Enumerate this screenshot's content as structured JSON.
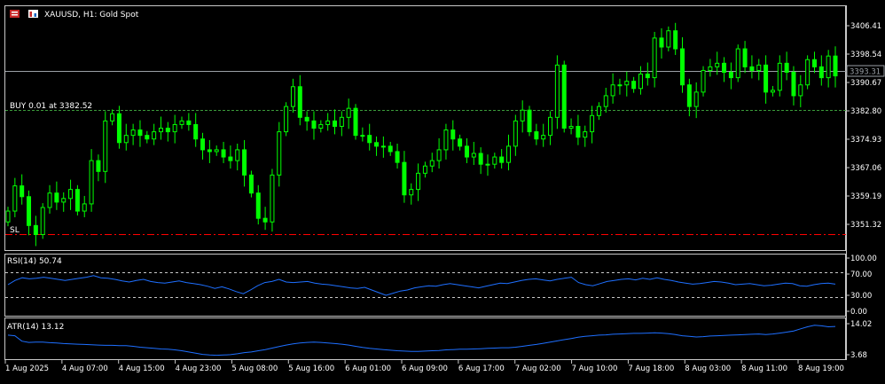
{
  "header": {
    "symbol_title": "XAUUSD, H1:  Gold Spot"
  },
  "trade": {
    "buy_label": "BUY 0.01 at 3382.52",
    "sl_label": "SL",
    "current_price_label": "3393.31"
  },
  "colors": {
    "background": "#000000",
    "candles": "#00ff00",
    "grid_border": "#c8c8c8",
    "buy_line": "#3a9a3a",
    "sl_line": "#ff0000",
    "indicator_line": "#1e6fff",
    "price_box": "#000000"
  },
  "chart_data": [
    {
      "type": "candlestick",
      "title": "XAUUSD, H1:  Gold Spot",
      "y_ticks": [
        "3406.41",
        "3398.54",
        "3390.67",
        "3382.80",
        "3374.93",
        "3367.06",
        "3359.19",
        "3351.32"
      ],
      "ylim": [
        3346.5,
        3410.5
      ],
      "x_tick_labels": [
        "1 Aug 2025",
        "4 Aug 07:00",
        "4 Aug 15:00",
        "4 Aug 23:00",
        "5 Aug 08:00",
        "5 Aug 16:00",
        "6 Aug 01:00",
        "6 Aug 09:00",
        "6 Aug 17:00",
        "7 Aug 02:00",
        "7 Aug 10:00",
        "7 Aug 18:00",
        "8 Aug 03:00",
        "8 Aug 11:00",
        "8 Aug 19:00"
      ],
      "buy_price": 3382.52,
      "stop_loss": 3348.5,
      "current_price": 3393.31,
      "closes": [
        3355.0,
        3362.0,
        3359.0,
        3351.0,
        3348.5,
        3356.0,
        3360.0,
        3357.5,
        3358.5,
        3361.0,
        3355.0,
        3357.0,
        3369.0,
        3366.0,
        3380.0,
        3382.0,
        3374.0,
        3376.0,
        3377.5,
        3376.0,
        3375.0,
        3377.0,
        3378.0,
        3377.0,
        3379.0,
        3380.0,
        3379.0,
        3375.0,
        3372.0,
        3371.5,
        3372.0,
        3370.0,
        3369.0,
        3372.0,
        3365.0,
        3360.0,
        3353.0,
        3352.0,
        3365.0,
        3377.0,
        3384.0,
        3389.5,
        3381.0,
        3380.0,
        3378.0,
        3379.0,
        3380.0,
        3378.5,
        3381.0,
        3383.5,
        3376.0,
        3376.0,
        3374.0,
        3373.0,
        3373.0,
        3371.5,
        3368.5,
        3359.5,
        3361.0,
        3365.5,
        3367.5,
        3369.0,
        3372.0,
        3377.5,
        3375.0,
        3373.0,
        3370.0,
        3371.0,
        3368.0,
        3368.0,
        3370.0,
        3368.5,
        3373.0,
        3380.0,
        3383.0,
        3377.0,
        3375.0,
        3376.0,
        3381.0,
        3395.5,
        3378.0,
        3378.5,
        3375.5,
        3377.0,
        3381.5,
        3384.0,
        3387.0,
        3390.0,
        3390.0,
        3391.0,
        3389.0,
        3393.0,
        3392.0,
        3403.0,
        3400.5,
        3405.0,
        3400.0,
        3390.0,
        3384.0,
        3388.0,
        3394.0,
        3395.0,
        3396.0,
        3393.5,
        3392.0,
        3400.0,
        3395.0,
        3394.0,
        3395.5,
        3388.0,
        3388.5,
        3396.0,
        3393.5,
        3387.0,
        3390.0,
        3397.0,
        3395.0,
        3392.0,
        3398.0,
        3392.5
      ]
    },
    {
      "type": "line",
      "title": "RSI(14) 50.74",
      "y_ticks": [
        "100.00",
        "70.00",
        "30.00",
        "0.00"
      ],
      "ylim": [
        0,
        100
      ],
      "levels": [
        70,
        30
      ],
      "values": [
        50,
        58,
        63,
        61,
        62,
        64,
        62,
        60,
        58,
        60,
        62,
        64,
        67,
        63,
        62,
        60,
        57,
        55,
        58,
        60,
        56,
        54,
        53,
        55,
        57,
        54,
        52,
        50,
        47,
        43,
        46,
        42,
        37,
        33,
        40,
        48,
        54,
        56,
        60,
        55,
        54,
        55,
        56,
        53,
        51,
        50,
        48,
        46,
        44,
        43,
        45,
        40,
        35,
        30,
        34,
        38,
        40,
        44,
        46,
        48,
        47,
        50,
        52,
        50,
        48,
        46,
        44,
        47,
        50,
        53,
        52,
        55,
        58,
        60,
        61,
        59,
        57,
        60,
        62,
        64,
        54,
        50,
        48,
        52,
        56,
        58,
        60,
        61,
        59,
        62,
        60,
        63,
        60,
        58,
        55,
        53,
        51,
        52,
        54,
        56,
        55,
        53,
        50,
        51,
        52,
        50,
        48,
        49,
        51,
        53,
        52,
        48,
        47,
        50,
        52,
        53,
        51
      ]
    },
    {
      "type": "line",
      "title": "ATR(14) 13.12",
      "y_ticks": [
        "14.02",
        "3.68"
      ],
      "ylim": [
        2.5,
        15.0
      ],
      "values": [
        10.2,
        10.0,
        8.2,
        7.8,
        7.9,
        7.9,
        7.7,
        7.6,
        7.4,
        7.3,
        7.2,
        7.1,
        7.0,
        6.9,
        6.8,
        6.8,
        6.7,
        6.7,
        6.5,
        6.2,
        6.0,
        5.8,
        5.6,
        5.5,
        5.3,
        5.0,
        4.6,
        4.2,
        3.8,
        3.6,
        3.5,
        3.6,
        3.7,
        4.0,
        4.4,
        4.6,
        5.0,
        5.4,
        5.9,
        6.4,
        6.9,
        7.3,
        7.6,
        7.8,
        7.9,
        7.8,
        7.6,
        7.4,
        7.2,
        6.9,
        6.5,
        6.1,
        5.8,
        5.6,
        5.4,
        5.2,
        5.0,
        4.9,
        4.8,
        4.8,
        4.9,
        5.0,
        5.1,
        5.3,
        5.4,
        5.5,
        5.5,
        5.6,
        5.7,
        5.8,
        5.9,
        6.0,
        6.0,
        6.2,
        6.5,
        6.8,
        7.1,
        7.5,
        7.9,
        8.3,
        8.7,
        9.1,
        9.5,
        9.8,
        10.0,
        10.2,
        10.3,
        10.5,
        10.6,
        10.7,
        10.8,
        10.8,
        10.9,
        11.0,
        10.9,
        10.7,
        10.4,
        10.0,
        9.8,
        9.6,
        9.7,
        9.9,
        10.0,
        10.1,
        10.2,
        10.3,
        10.4,
        10.5,
        10.6,
        10.4,
        10.6,
        10.9,
        11.2,
        11.6,
        12.3,
        13.0,
        13.5,
        13.3,
        13.0,
        13.1
      ]
    }
  ],
  "indicators": {
    "rsi_label": "RSI(14) 50.74",
    "atr_label": "ATR(14) 13.12"
  },
  "icons": [
    "chart-type-icon",
    "auto-trading-icon"
  ]
}
